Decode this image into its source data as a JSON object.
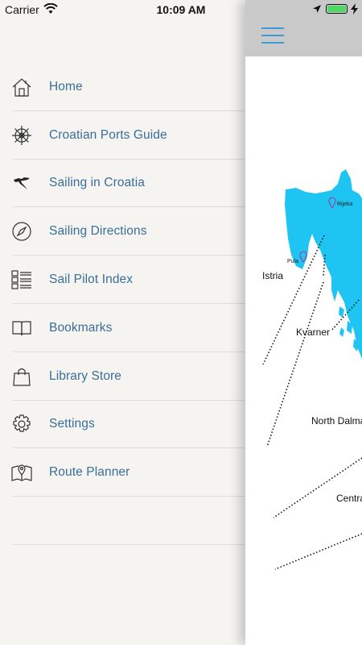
{
  "status_bar": {
    "carrier": "Carrier",
    "time": "10:09 AM",
    "battery_level": 1.0,
    "battery_color": "#4cd964"
  },
  "menu": {
    "items": [
      {
        "label": "Home",
        "icon": "home-icon"
      },
      {
        "label": "Croatian Ports Guide",
        "icon": "ship-wheel-icon"
      },
      {
        "label": "Sailing in Croatia",
        "icon": "croatia-map-icon"
      },
      {
        "label": "Sailing Directions",
        "icon": "compass-icon"
      },
      {
        "label": "Sail Pilot Index",
        "icon": "index-list-icon"
      },
      {
        "label": "Bookmarks",
        "icon": "book-icon"
      },
      {
        "label": "Library Store",
        "icon": "shopping-bag-icon"
      },
      {
        "label": "Settings",
        "icon": "gear-icon"
      },
      {
        "label": "Route Planner",
        "icon": "map-pin-icon"
      }
    ],
    "label_color": "#3a6e99"
  },
  "main": {
    "menu_button_icon": "hamburger-icon",
    "accent_color": "#3f9ad4",
    "map": {
      "sea_color": "#1ec4f2",
      "labels": {
        "istria": "Istria",
        "kvarner": "Kvarner",
        "north_dalmatia": "North Dalmatia",
        "central": "Central",
        "rijeka": "Rijeka",
        "pula": "Pula"
      }
    }
  }
}
